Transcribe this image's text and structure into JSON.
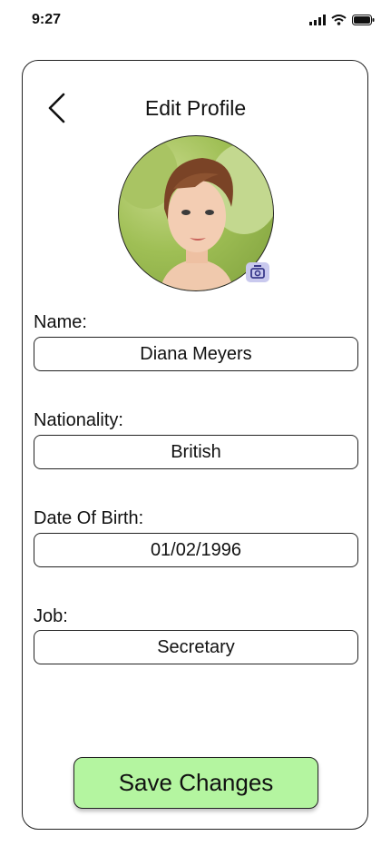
{
  "status_bar": {
    "time": "9:27",
    "icons": [
      "signal-icon",
      "wifi-icon",
      "battery-icon"
    ]
  },
  "header": {
    "back_icon": "chevron-left-icon",
    "title": "Edit Profile"
  },
  "avatar": {
    "camera_icon": "camera-icon"
  },
  "form": {
    "fields": [
      {
        "label": "Name:",
        "value": "Diana Meyers"
      },
      {
        "label": "Nationality:",
        "value": "British"
      },
      {
        "label": "Date Of Birth:",
        "value": "01/02/1996"
      },
      {
        "label": "Job:",
        "value": "Secretary"
      }
    ]
  },
  "actions": {
    "save_label": "Save Changes"
  },
  "colors": {
    "save_button": "#b4f5a0",
    "camera_badge": "#c9c9ee",
    "camera_glyph": "#3a3a8c"
  }
}
